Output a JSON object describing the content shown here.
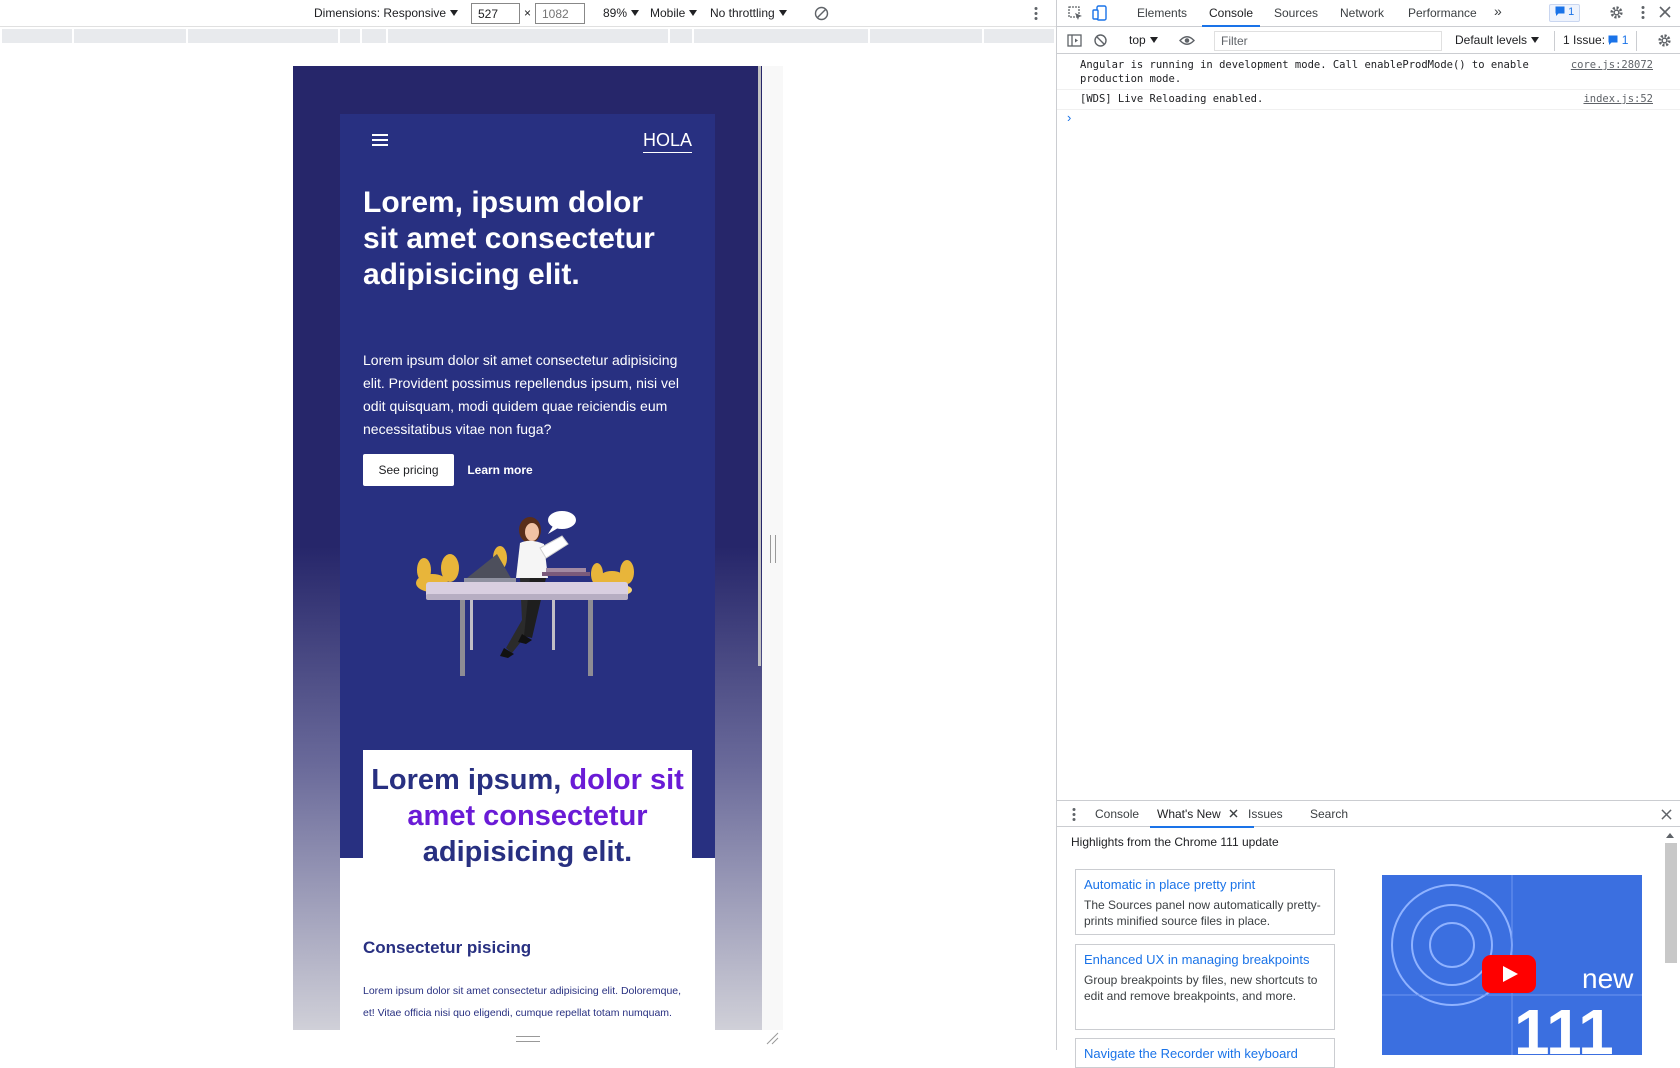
{
  "device_toolbar": {
    "dimensions_label": "Dimensions: Responsive",
    "width": "527",
    "height_placeholder": "1082",
    "times": "×",
    "zoom": "89%",
    "device_type": "Mobile",
    "throttling": "No throttling"
  },
  "site": {
    "brand": "HOLA",
    "hero_title": "Lorem, ipsum dolor sit amet consectetur adipisicing elit.",
    "hero_text": "Lorem ipsum dolor sit amet consectetur adipisicing elit. Provident possimus repellendus ipsum, nisi vel odit quisquam, modi quidem quae reiciendis eum necessitatibus vitae non fuga?",
    "primary_button": "See pricing",
    "secondary_button": "Learn more",
    "card_title_part1": "Lorem ipsum, ",
    "card_title_accent": "dolor sit amet consectetur",
    "card_title_part2": "adipisicing elit.",
    "section_title": "Consectetur pisicing",
    "section_text": "Lorem ipsum dolor sit amet consectetur adipisicing elit. Doloremque, et! Vitae officia nisi quo eligendi, cumque repellat totam numquam."
  },
  "devtools": {
    "tabs": [
      "Elements",
      "Console",
      "Sources",
      "Network",
      "Performance"
    ],
    "active_tab": "Console",
    "more_tabs": "»",
    "messages_count": "1",
    "context": "top",
    "filter_placeholder": "Filter",
    "levels": "Default levels",
    "issues_label": "1 Issue:",
    "issues_count": "1",
    "logs": [
      {
        "message": "Angular is running in development mode. Call enableProdMode() to enable production mode.",
        "source": "core.js:28072"
      },
      {
        "message": "[WDS] Live Reloading enabled.",
        "source": "index.js:52"
      }
    ],
    "prompt": "›"
  },
  "drawer": {
    "tabs": [
      "Console",
      "What's New",
      "Issues",
      "Search"
    ],
    "active_tab": "What's New",
    "highlights": "Highlights from the Chrome 111 update",
    "cards": [
      {
        "title": "Automatic in place pretty print",
        "desc": "The Sources panel now automatically pretty-prints minified source files in place."
      },
      {
        "title": "Enhanced UX in managing breakpoints",
        "desc": "Group breakpoints by files, new shortcuts to edit and remove breakpoints, and more."
      },
      {
        "title": "Navigate the Recorder with keyboard",
        "desc": ""
      }
    ],
    "video_text_new": "new",
    "video_text_version": "111"
  },
  "colors": {
    "hero_bg": "#283081",
    "accent_purple": "#6a1bd6",
    "devtools_blue": "#1a73e8"
  }
}
